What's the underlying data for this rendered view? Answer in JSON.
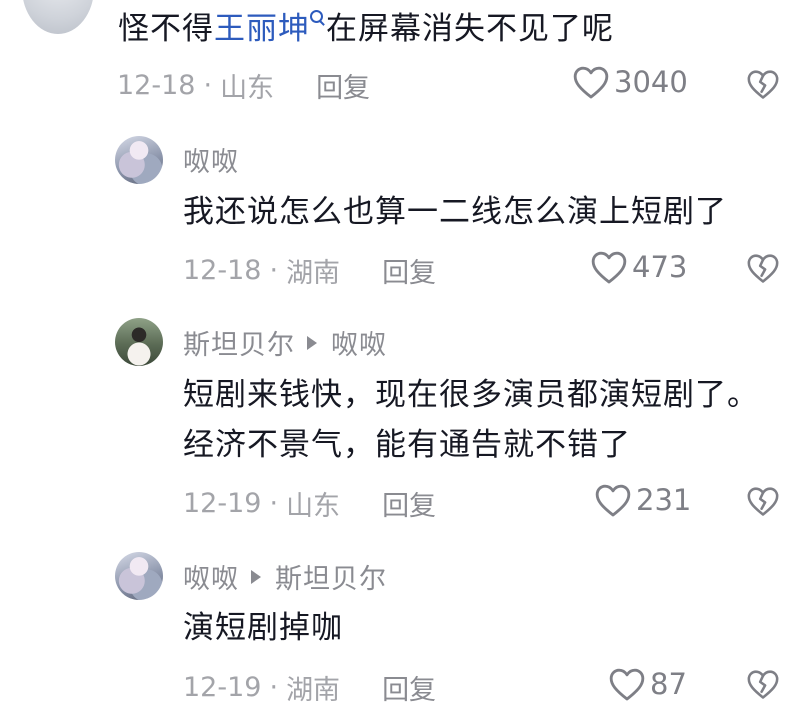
{
  "comments": [
    {
      "text_before": "怪不得",
      "text_link": "王丽坤",
      "text_after": "在屏幕消失不见了呢",
      "date": "12-18",
      "location": "山东",
      "reply_label": "回复",
      "likes": "3040"
    },
    {
      "user": "呶呶",
      "text": "我还说怎么也算一二线怎么演上短剧了",
      "date": "12-18",
      "location": "湖南",
      "reply_label": "回复",
      "likes": "473"
    },
    {
      "user": "斯坦贝尔",
      "reply_to": "呶呶",
      "text_line1": "短剧来钱快，现在很多演员都演短剧了。",
      "text_line2": "经济不景气，能有通告就不错了",
      "date": "12-19",
      "location": "山东",
      "reply_label": "回复",
      "likes": "231"
    },
    {
      "user": "呶呶",
      "reply_to": "斯坦贝尔",
      "text": "演短剧掉咖",
      "date": "12-19",
      "location": "湖南",
      "reply_label": "回复",
      "likes": "87"
    }
  ],
  "colors": {
    "text": "#161823",
    "meta": "#a3a4a9",
    "username": "#8a8b91",
    "link": "#2d5bbd"
  },
  "icons": {
    "like": "heart-outline-icon",
    "dislike": "broken-heart-icon",
    "reply_arrow": "triangle-right-icon",
    "search": "search-icon"
  }
}
